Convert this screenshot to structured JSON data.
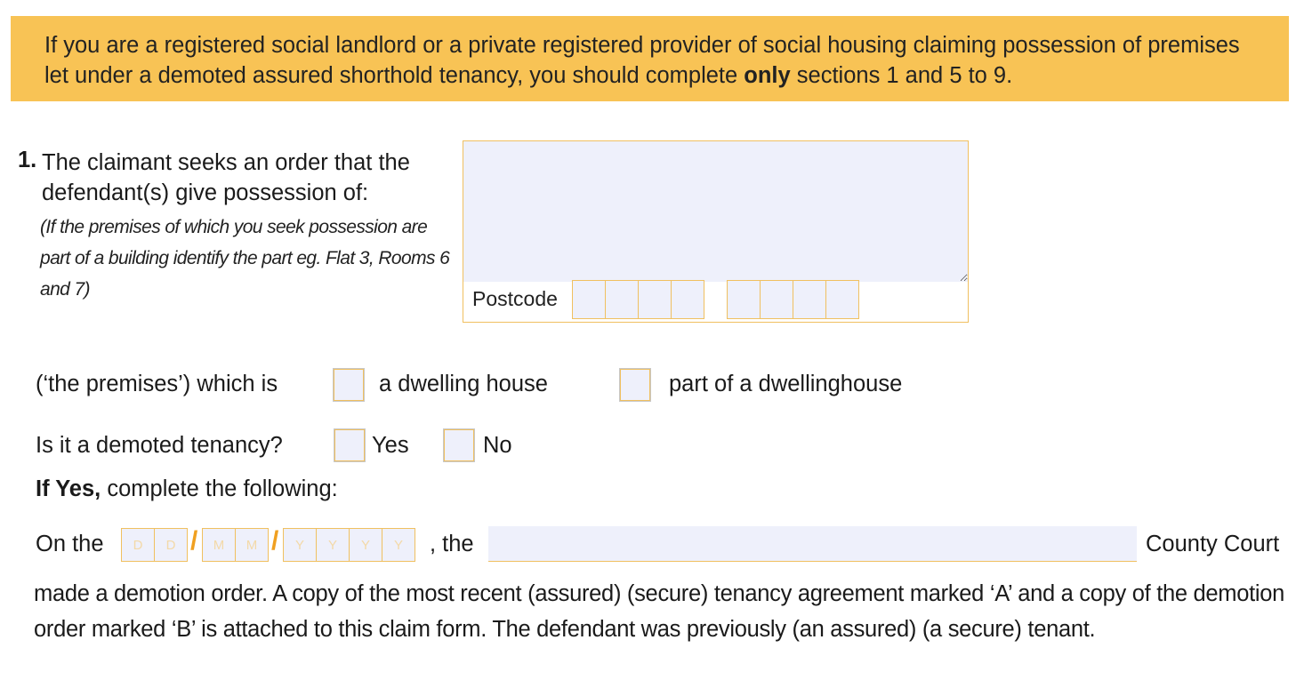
{
  "banner": {
    "text_before": "If you are a registered social landlord or a private registered provider of social housing claiming possession of premises let under a demoted assured shorthold tenancy, you should complete ",
    "bold": "only",
    "text_after": " sections 1 and 5 to 9."
  },
  "question1": {
    "number": "1.",
    "title": "The claimant seeks an order that the defendant(s) give possession of:",
    "hint": "(If the premises of which you seek possession are part of a building identify the part eg. Flat 3, Rooms 6 and 7)",
    "postcode_label": "Postcode"
  },
  "premises_row": {
    "label": "(‘the premises’) which is",
    "option1": "a dwelling house",
    "option2": "part of a dwellinghouse"
  },
  "demoted_row": {
    "label": "Is it a demoted tenancy?",
    "yes": "Yes",
    "no": "No"
  },
  "if_yes": {
    "bold": "If Yes,",
    "text": " complete the following:"
  },
  "date_row": {
    "on_the": "On the",
    "the": ", the",
    "county_court": "County Court",
    "day_placeholder": "D",
    "month_placeholder": "M",
    "year_placeholder": "Y",
    "separator": "/"
  },
  "paragraph": "made a demotion order. A copy of the most recent (assured) (secure) tenancy agreement marked ‘A’ and a copy of the demotion order marked ‘B’ is attached to this claim form. The defendant was previously (an assured) (a secure) tenant."
}
